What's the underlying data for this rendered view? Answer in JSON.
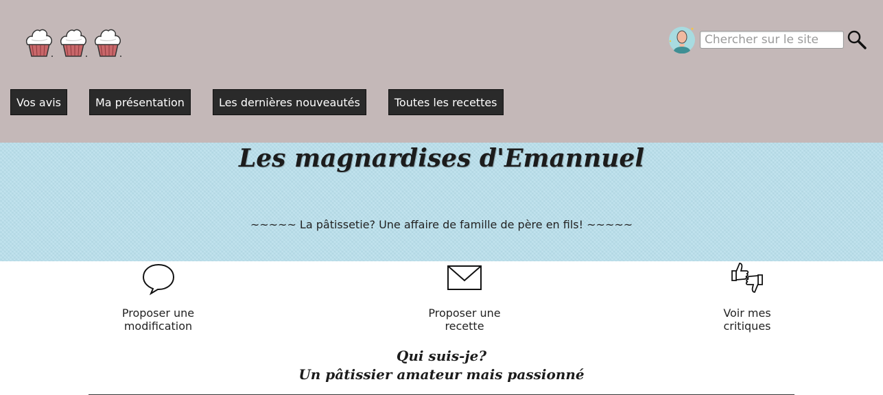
{
  "header": {
    "logo_icons": [
      "cupcake-icon",
      "cupcake-icon",
      "cupcake-icon"
    ],
    "search": {
      "placeholder": "Chercher sur le site",
      "value": ""
    },
    "colors": {
      "header_bg": "#c4b8b8",
      "nav_bg": "#2a2a2a",
      "banner_bg": "#b9dfec"
    }
  },
  "nav": {
    "items": [
      {
        "label": "Vos avis"
      },
      {
        "label": "Ma présentation"
      },
      {
        "label": "Les dernières nouveautés"
      },
      {
        "label": "Toutes les recettes"
      }
    ]
  },
  "banner": {
    "title": "Les magnardises d'Emannuel",
    "tagline": "~~~~~ La pâtissetie? Une affaire de famille de père en fils! ~~~~~"
  },
  "actions": [
    {
      "label": "Proposer une modification",
      "icon": "speech-bubble-icon"
    },
    {
      "label": "Proposer une recette",
      "icon": "envelope-icon"
    },
    {
      "label": "Voir mes critiques",
      "icon": "thumbs-up-down-icon"
    }
  ],
  "about": {
    "heading": "Qui suis-je?",
    "subheading": "Un pâtissier amateur mais passionné"
  }
}
